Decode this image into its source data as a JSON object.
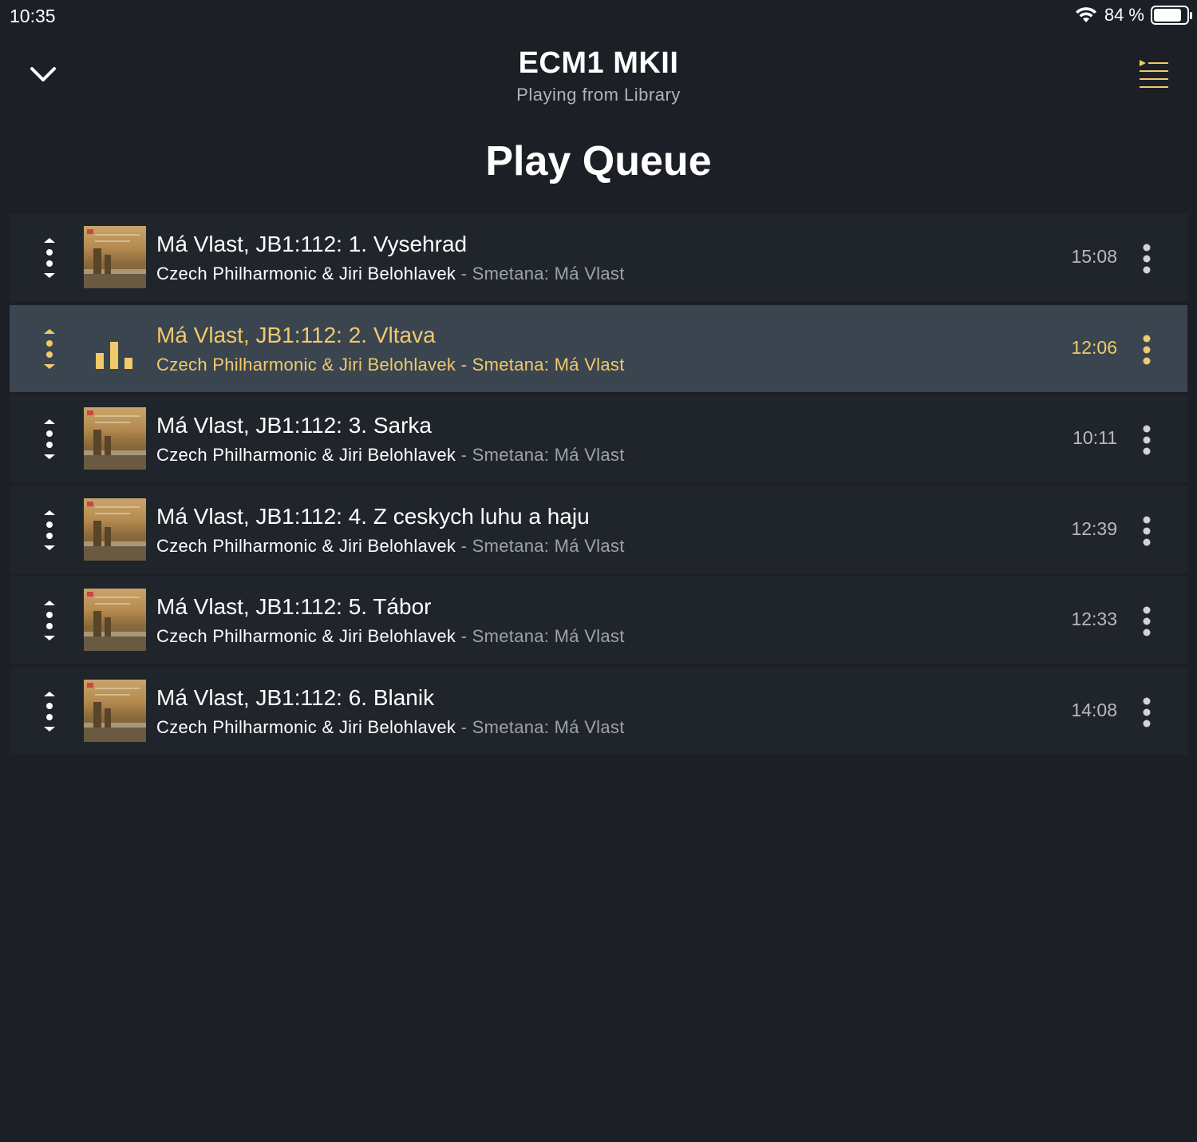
{
  "status_bar": {
    "time": "10:35",
    "battery_text": "84 %",
    "battery_level": 0.84
  },
  "header": {
    "device_name": "ECM1 MKII",
    "subtitle": "Playing from Library"
  },
  "page_title": "Play Queue",
  "colors": {
    "background": "#1c1f26",
    "row": "#20242b",
    "active_row": "#3a4550",
    "accent": "#f2c96b",
    "secondary_text": "#9ea3aa"
  },
  "queue": [
    {
      "title": "Má Vlast, JB1:112: 1. Vysehrad",
      "artist": "Czech Philharmonic & Jiri Belohlavek",
      "separator": " - ",
      "album": "Smetana: Má Vlast",
      "duration": "15:08",
      "playing": false
    },
    {
      "title": "Má Vlast, JB1:112: 2. Vltava",
      "artist": "Czech Philharmonic & Jiri Belohlavek",
      "separator": " - ",
      "album": "Smetana: Má Vlast",
      "duration": "12:06",
      "playing": true
    },
    {
      "title": "Má Vlast, JB1:112: 3. Sarka",
      "artist": "Czech Philharmonic & Jiri Belohlavek",
      "separator": " - ",
      "album": "Smetana: Má Vlast",
      "duration": "10:11",
      "playing": false
    },
    {
      "title": "Má Vlast, JB1:112: 4. Z ceskych luhu a haju",
      "artist": "Czech Philharmonic & Jiri Belohlavek",
      "separator": " - ",
      "album": "Smetana: Má Vlast",
      "duration": "12:39",
      "playing": false
    },
    {
      "title": "Má Vlast, JB1:112: 5. Tábor",
      "artist": "Czech Philharmonic & Jiri Belohlavek",
      "separator": " - ",
      "album": "Smetana: Má Vlast",
      "duration": "12:33",
      "playing": false
    },
    {
      "title": "Má Vlast, JB1:112: 6. Blanik",
      "artist": "Czech Philharmonic & Jiri Belohlavek",
      "separator": " - ",
      "album": "Smetana: Má Vlast",
      "duration": "14:08",
      "playing": false
    }
  ],
  "icons": {
    "collapse": "chevron-down-icon",
    "queue_menu": "queue-list-icon",
    "reorder": "reorder-handle-icon",
    "more": "more-vertical-icon",
    "now_playing": "equalizer-icon",
    "wifi": "wifi-icon",
    "battery": "battery-icon"
  }
}
